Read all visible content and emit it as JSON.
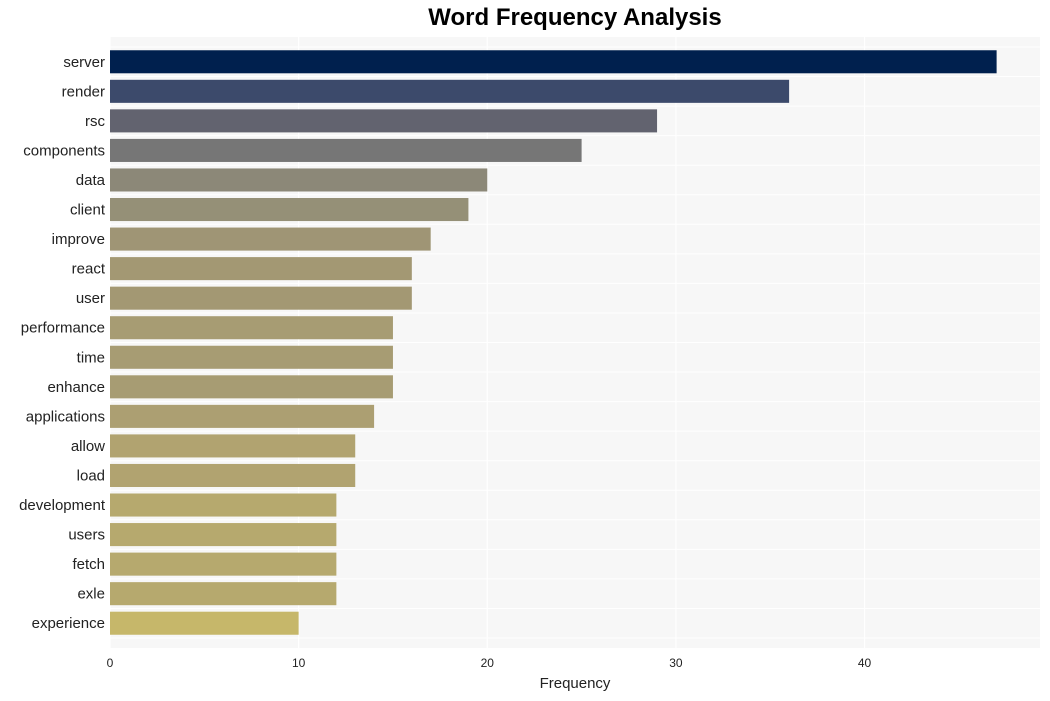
{
  "chart_data": {
    "type": "bar",
    "orientation": "horizontal",
    "title": "Word Frequency Analysis",
    "xlabel": "Frequency",
    "ylabel": "",
    "xlim": [
      0,
      49.3
    ],
    "xticks": [
      0,
      10,
      20,
      30,
      40
    ],
    "grid": true,
    "categories": [
      "server",
      "render",
      "rsc",
      "components",
      "data",
      "client",
      "improve",
      "react",
      "user",
      "performance",
      "time",
      "enhance",
      "applications",
      "allow",
      "load",
      "development",
      "users",
      "fetch",
      "exle",
      "experience"
    ],
    "values": [
      47,
      36,
      29,
      25,
      20,
      19,
      17,
      16,
      16,
      15,
      15,
      15,
      14,
      13,
      13,
      12,
      12,
      12,
      12,
      10
    ],
    "colors": [
      "#00204e",
      "#3c4a6b",
      "#62636f",
      "#767676",
      "#8c8878",
      "#959077",
      "#9f9575",
      "#a39873",
      "#a39873",
      "#a79c73",
      "#a79c73",
      "#a79c73",
      "#ac9f72",
      "#b1a370",
      "#b1a370",
      "#b6a96e",
      "#b6a96e",
      "#b6a96e",
      "#b6a96e",
      "#c6b76a"
    ]
  }
}
